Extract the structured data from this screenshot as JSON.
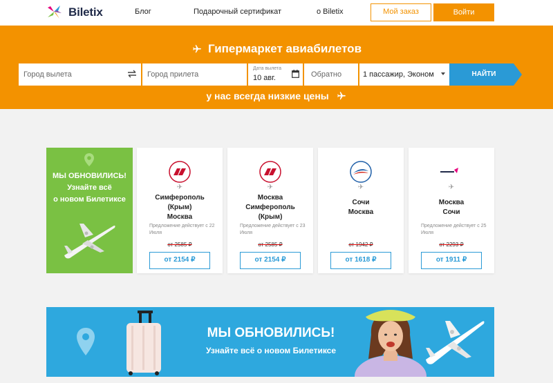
{
  "header": {
    "logo_text": "Biletix",
    "nav": [
      "Блог",
      "Подарочный сертификат",
      "о Biletix"
    ],
    "my_order": "Мой заказ",
    "login": "Войти"
  },
  "hero": {
    "title": "Гипермаркет авиабилетов",
    "subtitle": "у нас всегда низкие цены",
    "search": {
      "from_placeholder": "Город вылета",
      "to_placeholder": "Город прилета",
      "date_label": "Дата вылета",
      "date_value": "10 авг.",
      "return_placeholder": "Обратно",
      "passengers": "1 пассажир, Эконом",
      "button": "НАЙТИ"
    }
  },
  "promo": {
    "lines": [
      "МЫ ОБНОВИЛИСЬ!",
      "Узнайте всё",
      "о новом Билетиксе"
    ]
  },
  "deals": [
    {
      "airline": "nordwind-logo",
      "route": [
        "Симферополь",
        "(Крым)",
        "Москва"
      ],
      "offer": "Предложение действует с 22 Июля",
      "old_price": "от 2585 ₽",
      "price": "от 2154 ₽"
    },
    {
      "airline": "nordwind-logo",
      "route": [
        "Москва",
        "Симферополь",
        "(Крым)"
      ],
      "offer": "Предложение действует с 23 Июля",
      "old_price": "от 2585 ₽",
      "price": "от 2154 ₽"
    },
    {
      "airline": "rossiya-logo",
      "route": [
        "Сочи",
        "Москва"
      ],
      "offer": "",
      "old_price": "от 1942 ₽",
      "price": "от 1618 ₽"
    },
    {
      "airline": "smartavia-logo",
      "route": [
        "Москва",
        "Сочи"
      ],
      "offer": "Предложение действует с 25 Июля",
      "old_price": "от 2293 ₽",
      "price": "от 1911 ₽"
    }
  ],
  "banner": {
    "title": "МЫ ОБНОВИЛИСЬ!",
    "subtitle": "Узнайте всё о новом Билетиксе"
  },
  "colors": {
    "brand_orange": "#f39200",
    "search_blue": "#2a9ad6",
    "promo_green": "#7ac143",
    "banner_blue": "#2ea8de"
  }
}
